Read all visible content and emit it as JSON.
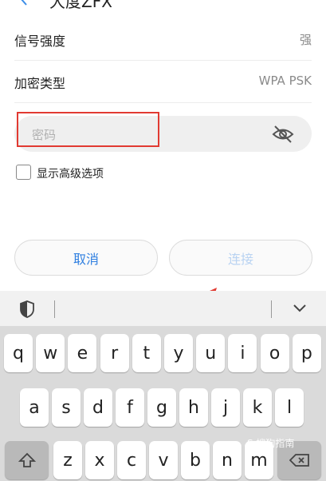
{
  "header": {
    "title": "大度ZFX"
  },
  "rows": [
    {
      "label": "信号强度",
      "value": "强"
    },
    {
      "label": "加密类型",
      "value": "WPA PSK"
    }
  ],
  "password": {
    "placeholder": "密码",
    "value": ""
  },
  "advanced": {
    "label": "显示高级选项",
    "checked": false
  },
  "buttons": {
    "cancel": "取消",
    "connect": "连接"
  },
  "keyboard": {
    "row1": [
      "q",
      "w",
      "e",
      "r",
      "t",
      "y",
      "u",
      "i",
      "o",
      "p"
    ],
    "row2": [
      "a",
      "s",
      "d",
      "f",
      "g",
      "h",
      "j",
      "k",
      "l"
    ],
    "row3": [
      "z",
      "x",
      "c",
      "v",
      "b",
      "n",
      "m"
    ]
  },
  "watermark": "S 搜狗指南"
}
